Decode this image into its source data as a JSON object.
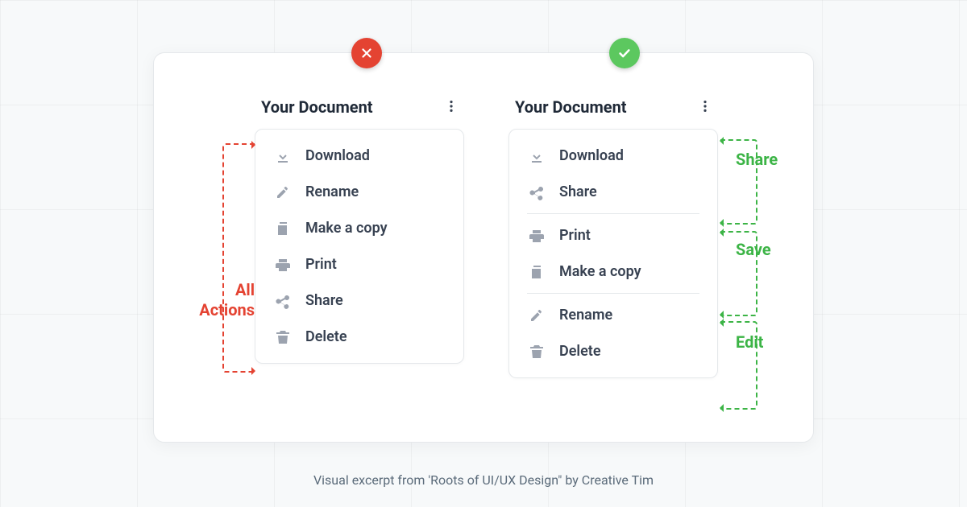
{
  "colors": {
    "bad": "#e44332",
    "good": "#5cc85f",
    "anno_good": "#3cb446",
    "text": "#374151",
    "icon": "#9ca3af"
  },
  "caption": "Visual excerpt from 'Roots of UI/UX Design\" by Creative Tim",
  "bad_panel": {
    "title": "Your Document",
    "annotation": "All\nActions",
    "items": [
      {
        "icon": "download",
        "label": "Download"
      },
      {
        "icon": "pencil",
        "label": "Rename"
      },
      {
        "icon": "copy",
        "label": "Make a copy"
      },
      {
        "icon": "print",
        "label": "Print"
      },
      {
        "icon": "share",
        "label": "Share"
      },
      {
        "icon": "trash",
        "label": "Delete"
      }
    ]
  },
  "good_panel": {
    "title": "Your Document",
    "groups": [
      {
        "label": "Share",
        "items": [
          {
            "icon": "download",
            "label": "Download"
          },
          {
            "icon": "share",
            "label": "Share"
          }
        ]
      },
      {
        "label": "Save",
        "items": [
          {
            "icon": "print",
            "label": "Print"
          },
          {
            "icon": "copy",
            "label": "Make a copy"
          }
        ]
      },
      {
        "label": "Edit",
        "items": [
          {
            "icon": "pencil",
            "label": "Rename"
          },
          {
            "icon": "trash",
            "label": "Delete"
          }
        ]
      }
    ]
  }
}
